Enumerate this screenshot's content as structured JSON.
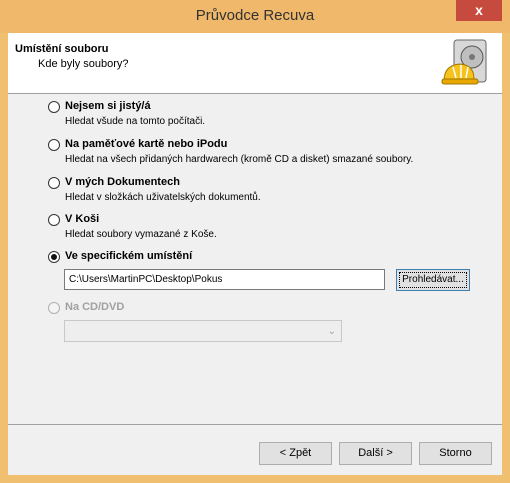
{
  "window": {
    "title": "Průvodce Recuva",
    "close_glyph": "x"
  },
  "header": {
    "title": "Umístění souboru",
    "subtitle": "Kde byly soubory?",
    "icon": "hard-drive-helmet-icon"
  },
  "options": [
    {
      "label": "Nejsem si jistý/á",
      "description": "Hledat všude na tomto počítači.",
      "selected": false,
      "disabled": false
    },
    {
      "label": "Na paměťové kartě nebo iPodu",
      "description": "Hledat na všech přidaných hardwarech (kromě CD a disket) smazané soubory.",
      "selected": false,
      "disabled": false
    },
    {
      "label": "V mých Dokumentech",
      "description": "Hledat v složkách uživatelských dokumentů.",
      "selected": false,
      "disabled": false
    },
    {
      "label": "V Koši",
      "description": "Hledat soubory vymazané z Koše.",
      "selected": false,
      "disabled": false
    },
    {
      "label": "Ve specifickém umístění",
      "description": "",
      "selected": true,
      "disabled": false
    },
    {
      "label": "Na CD/DVD",
      "description": "",
      "selected": false,
      "disabled": true
    }
  ],
  "path": {
    "value": "C:\\Users\\MartinPC\\Desktop\\Pokus",
    "browse_label": "Prohledávat..."
  },
  "cd_select": {
    "value": ""
  },
  "buttons": {
    "back": "< Zpět",
    "next": "Další >",
    "cancel": "Storno"
  },
  "colors": {
    "titlebar": "#f0b86a",
    "close": "#c74a3e",
    "dialog_bg": "#f0f0f0"
  }
}
